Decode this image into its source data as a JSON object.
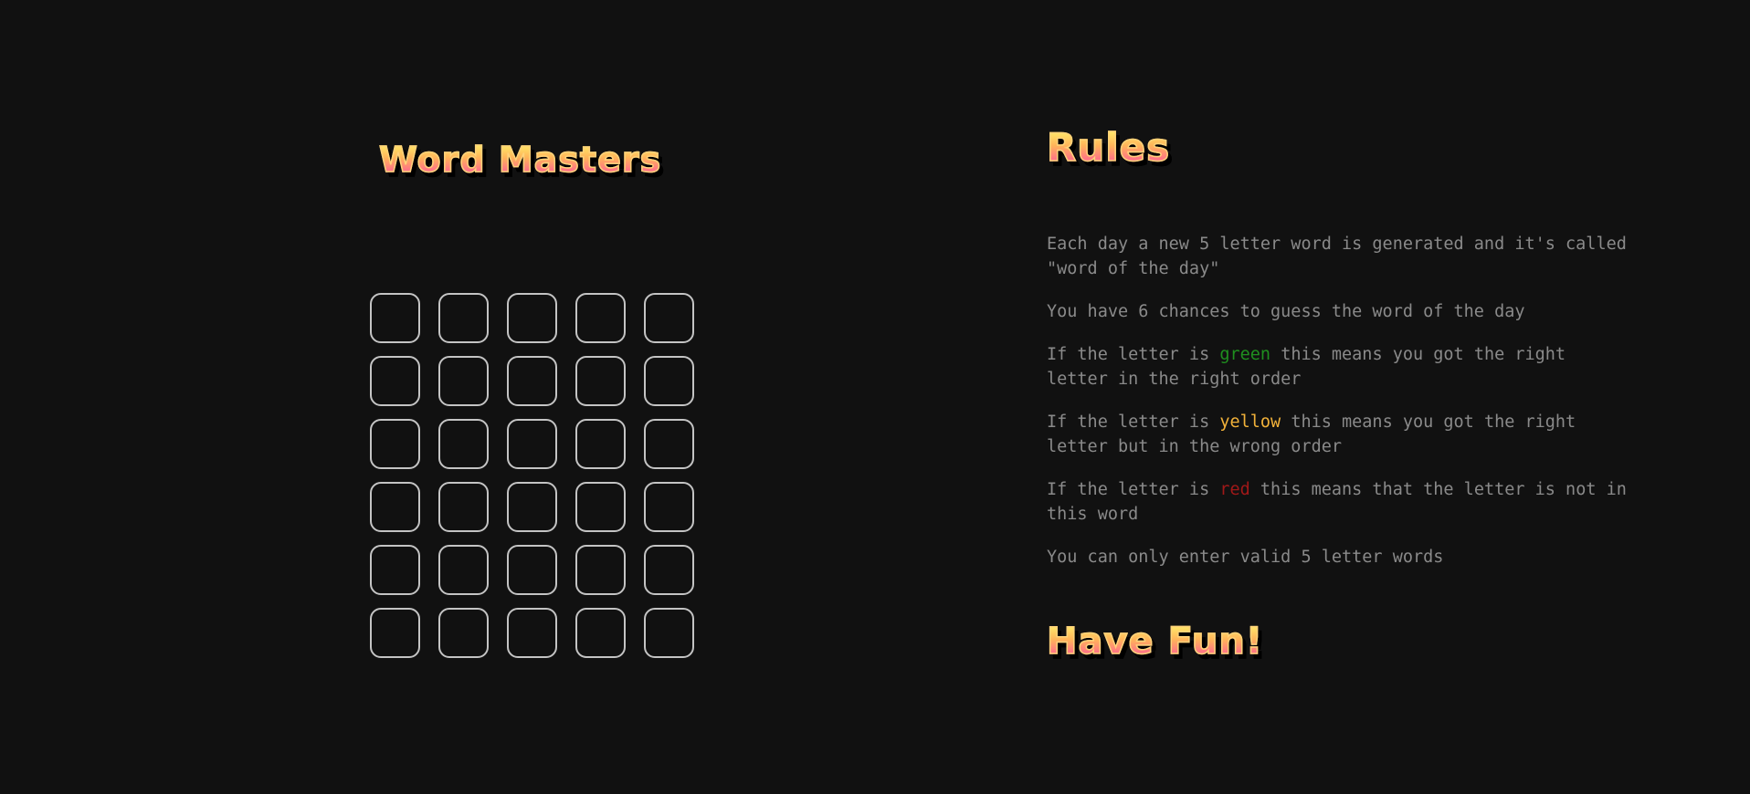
{
  "game": {
    "title": "Word Masters",
    "board": {
      "rows": 6,
      "columns": 5,
      "letters": [
        [
          "",
          "",
          "",
          "",
          ""
        ],
        [
          "",
          "",
          "",
          "",
          ""
        ],
        [
          "",
          "",
          "",
          "",
          ""
        ],
        [
          "",
          "",
          "",
          "",
          ""
        ],
        [
          "",
          "",
          "",
          "",
          ""
        ],
        [
          "",
          "",
          "",
          "",
          ""
        ]
      ]
    }
  },
  "rules": {
    "title": "Rules",
    "items": [
      {
        "segments": [
          {
            "text": "Each day a new 5 letter word is generated and it's called \"word of the day\""
          }
        ]
      },
      {
        "segments": [
          {
            "text": "You have 6 chances to guess the word of the day"
          }
        ]
      },
      {
        "segments": [
          {
            "text": "If the letter is "
          },
          {
            "text": "green",
            "color": "#1f8f1f"
          },
          {
            "text": " this means you got the right letter in the right order"
          }
        ]
      },
      {
        "segments": [
          {
            "text": "If the letter is "
          },
          {
            "text": "yellow",
            "color": "#f2b23a"
          },
          {
            "text": " this means you got the right letter but in the wrong order"
          }
        ]
      },
      {
        "segments": [
          {
            "text": "If the letter is "
          },
          {
            "text": "red",
            "color": "#a01818"
          },
          {
            "text": " this means that the letter is not in this word"
          }
        ]
      },
      {
        "segments": [
          {
            "text": "You can only enter valid 5 letter words"
          }
        ]
      }
    ],
    "footer": "Have Fun!"
  },
  "colors": {
    "background": "#111111",
    "tile_border": "#c4c4c4",
    "rules_text": "#8a8a8a",
    "title_gradient": [
      "#fff36b",
      "#ffb35a",
      "#ff4fa0"
    ]
  }
}
